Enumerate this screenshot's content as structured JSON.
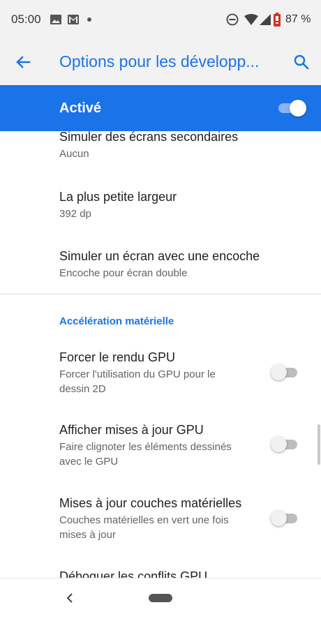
{
  "status_bar": {
    "time": "05:00",
    "battery_text": "87 %",
    "icons": [
      "image-icon",
      "gmail-icon",
      "notification-dot-icon",
      "do-not-disturb-icon",
      "wifi-icon",
      "signal-icon",
      "battery-icon"
    ]
  },
  "app_bar": {
    "title": "Options pour les développ...",
    "back_icon": "arrow-back-icon",
    "search_icon": "search-icon"
  },
  "master_switch": {
    "label": "Activé",
    "state": "on"
  },
  "items": [
    {
      "title": "Simuler des écrans secondaires",
      "subtitle": "Aucun"
    },
    {
      "title": "La plus petite largeur",
      "subtitle": "392 dp"
    },
    {
      "title": "Simuler un écran avec une encoche",
      "subtitle": "Encoche pour écran double"
    }
  ],
  "section": {
    "header": "Accélération matérielle",
    "items": [
      {
        "title": "Forcer le rendu GPU",
        "subtitle_line1": "Forcer l'utilisation du GPU pour le",
        "subtitle_line2": "dessin 2D",
        "toggle": "off"
      },
      {
        "title": "Afficher mises à jour GPU",
        "subtitle_line1": "Faire clignoter les éléments dessinés",
        "subtitle_line2": "avec le GPU",
        "toggle": "off"
      },
      {
        "title": "Mises à jour couches matérielles",
        "subtitle_line1": "Couches matérielles en vert une fois",
        "subtitle_line2": "mises à jour",
        "toggle": "off"
      },
      {
        "title": "Déboguer les conflits GPU"
      }
    ]
  },
  "colors": {
    "accent": "#1a73e8",
    "app_bar_bg": "#f2f2f2",
    "battery": "#d93025"
  }
}
